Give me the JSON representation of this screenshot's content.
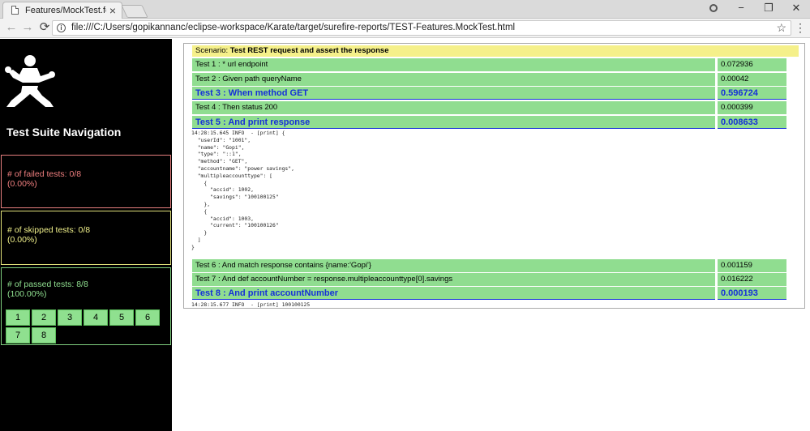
{
  "browser": {
    "tab_title": "Features/MockTest.featu",
    "url": "file:///C:/Users/gopikannanc/eclipse-workspace/Karate/target/surefire-reports/TEST-Features.MockTest.html"
  },
  "sidebar": {
    "title": "Test Suite Navigation",
    "failed": {
      "label": "# of failed tests: 0/8",
      "percent": "(0.00%)"
    },
    "skipped": {
      "label": "# of skipped tests: 0/8",
      "percent": "(0.00%)"
    },
    "passed": {
      "label": "# of passed tests: 8/8",
      "percent": "(100.00%)"
    },
    "test_links": [
      "1",
      "2",
      "3",
      "4",
      "5",
      "6",
      "7",
      "8"
    ]
  },
  "scenario": {
    "prefix": "Scenario: ",
    "name": "Test REST request and assert the response"
  },
  "steps": [
    {
      "name": "Test 1 : * url endpoint",
      "time": "0.072936"
    },
    {
      "name": "Test 2 : Given path queryName",
      "time": "0.00042"
    },
    {
      "name": "Test 3 : When method GET",
      "time": "0.596724"
    },
    {
      "name": "Test 4 : Then status 200",
      "time": "0.000399"
    },
    {
      "name": "Test 5 : And print response",
      "time": "0.008633"
    },
    {
      "name": "Test 6 : And match response contains {name:'Gopi'}",
      "time": "0.001159"
    },
    {
      "name": "Test 7 : And def accountNumber = response.multipleaccounttype[0].savings",
      "time": "0.016222"
    },
    {
      "name": "Test 8 : And print accountNumber",
      "time": "0.000193"
    }
  ],
  "logs": {
    "response": "14:28:15.645 INFO  - [print] {\n  \"userId\": \"1001\",\n  \"name\": \"Gopi\",\n  \"type\": \"::1\",\n  \"method\": \"GET\",\n  \"accountname\": \"power savings\",\n  \"multipleaccounttype\": [\n    {\n      \"accid\": 1002,\n      \"savings\": \"100100125\"\n    },\n    {\n      \"accid\": 1003,\n      \"current\": \"100100126\"\n    }\n  ]\n}",
    "account": "14:28:15.677 INFO  - [print] 100100125"
  }
}
